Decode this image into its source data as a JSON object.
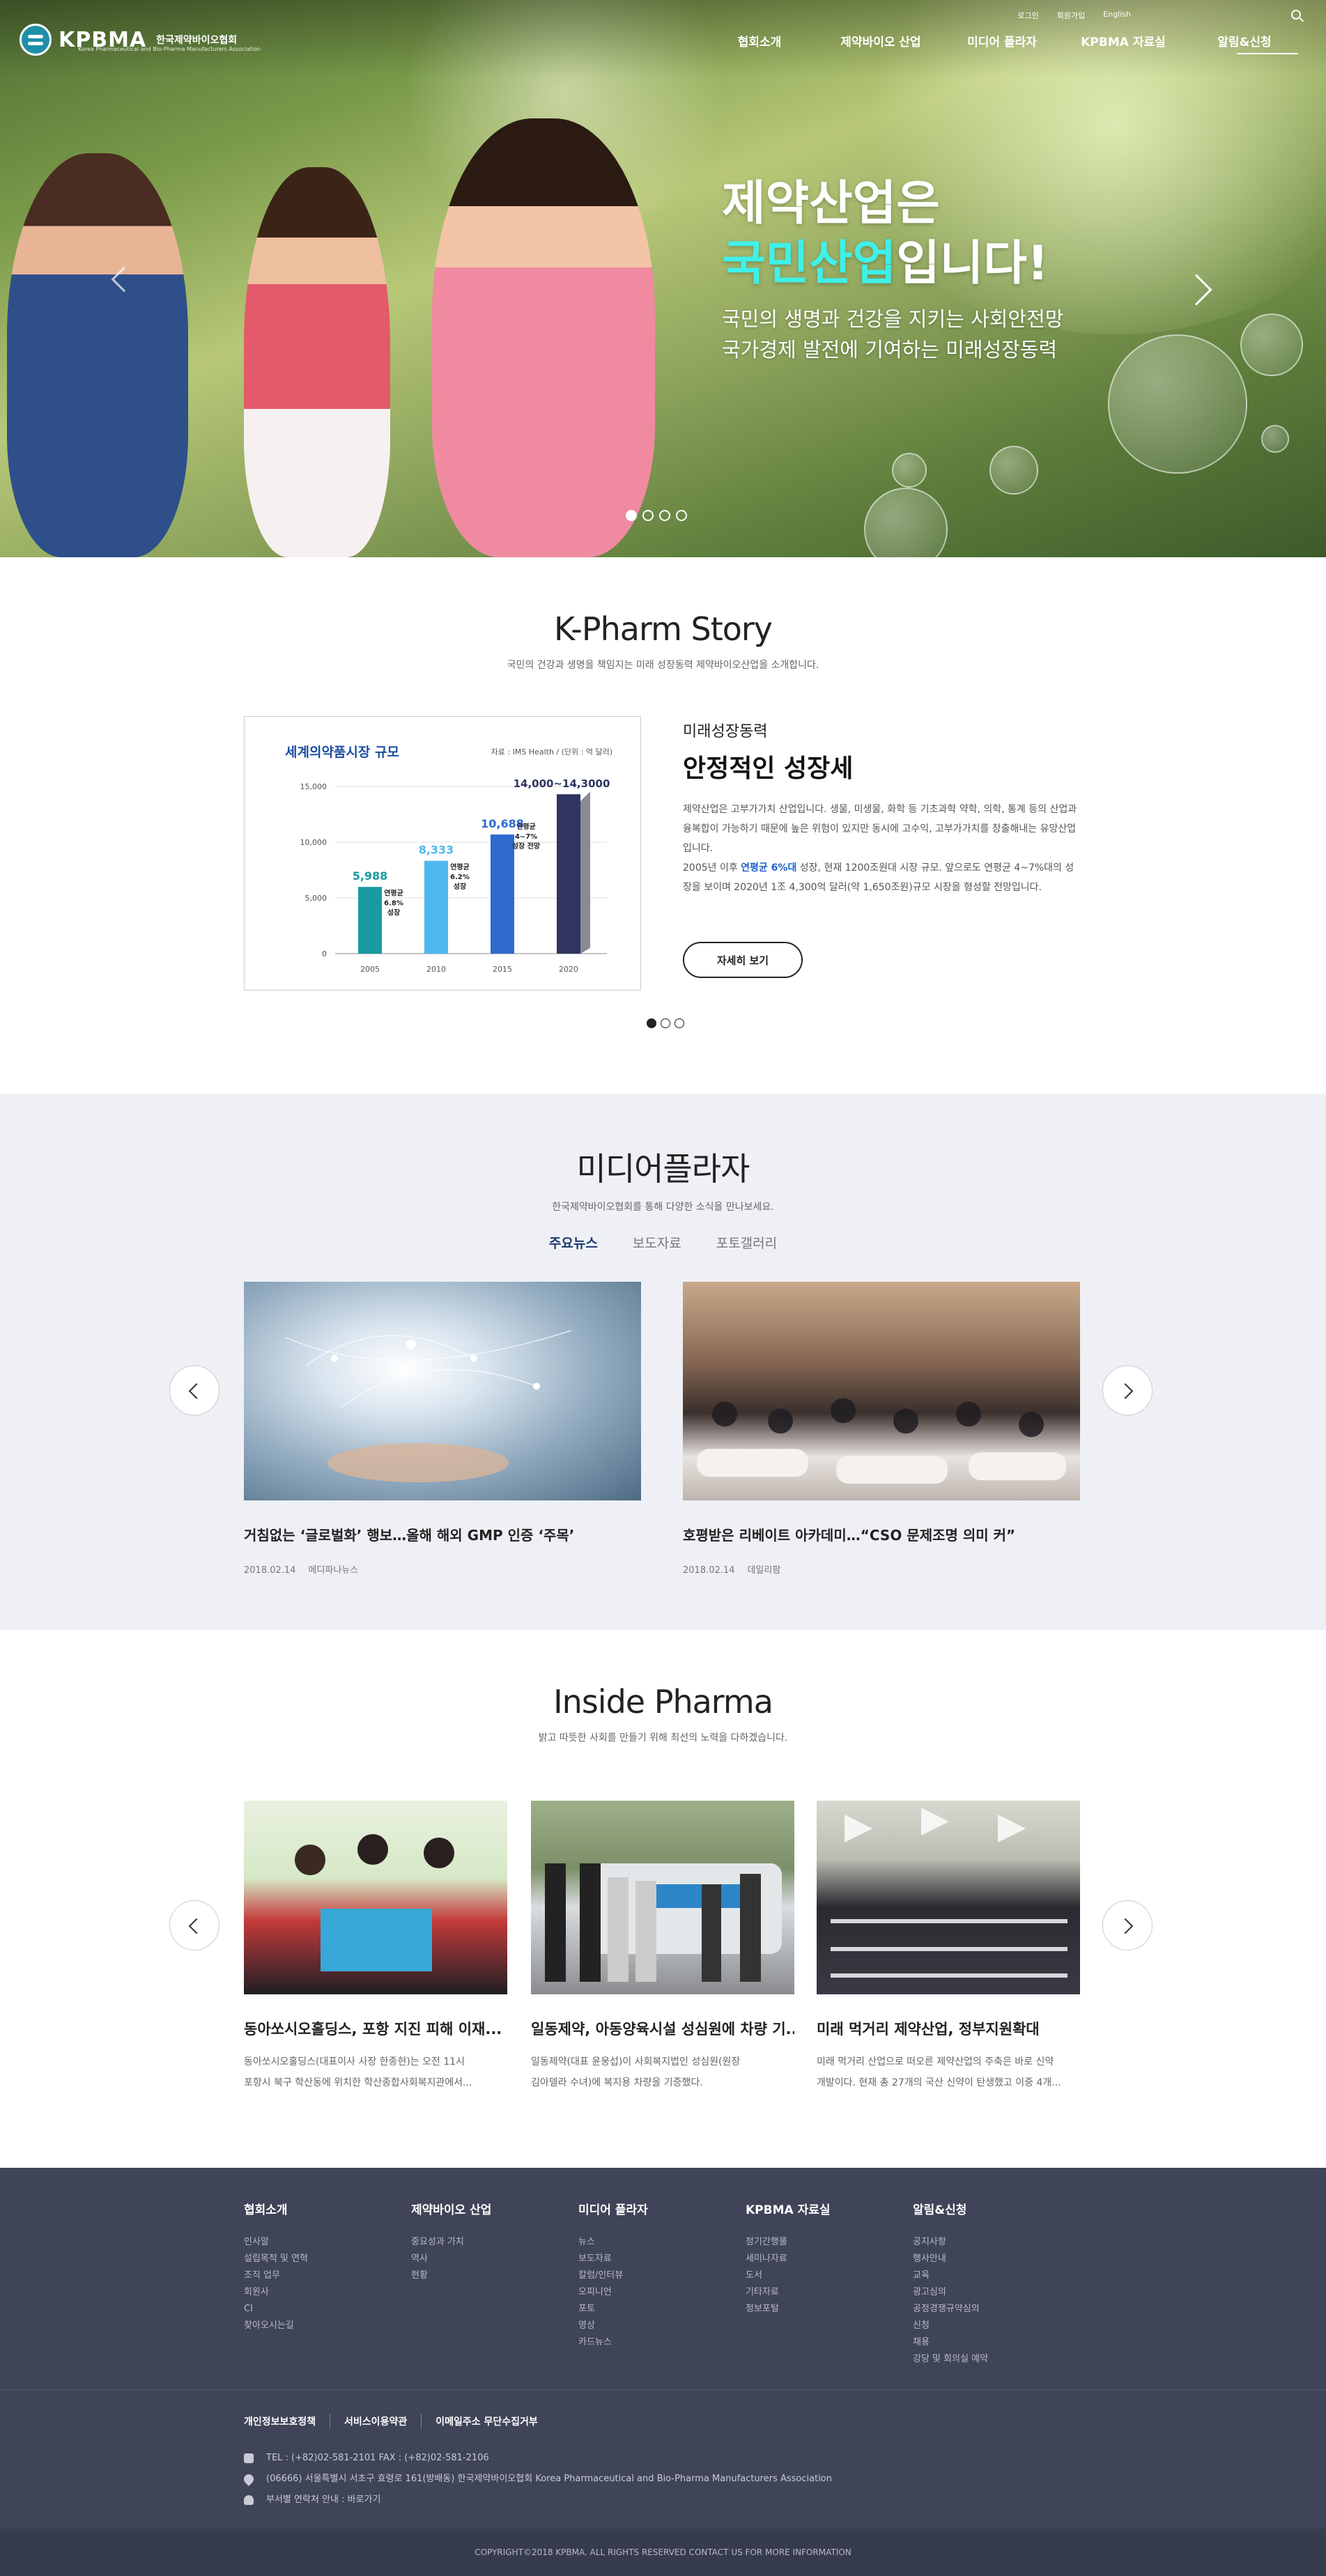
{
  "header": {
    "logo_text": "KPBMA",
    "logo_sub": "한국제약바이오협회",
    "logo_en": "Korea Pharmaceutical and Bio-Pharma Manufacturers Association",
    "util": [
      "로그인",
      "회원가입",
      "English"
    ],
    "gnb": [
      "협회소개",
      "제약바이오 산업",
      "미디어 플라자",
      "KPBMA 자료실",
      "알림&신청"
    ]
  },
  "hero": {
    "line1": "제약산업은",
    "line2_highlight": "국민산업",
    "line2_rest": "입니다!",
    "desc1": "국민의 생명과 건강을 지키는 사회안전망",
    "desc2": "국가경제 발전에 기여하는 미래성장동력"
  },
  "story": {
    "title": "K-Pharm Story",
    "subtitle": "국민의 건강과 생명을 책임지는 미래 성장동력 제약바이오산업을 소개합니다.",
    "kicker": "미래성장동력",
    "headline": "안정적인 성장세",
    "body1": "제약산업은 고부가가치 산업입니다. 생물, 미생물, 화학 등 기초과학 약학, 의학, 통계 등의 산업과 융복합이 가능하기 때문에 높은 위험이 있지만 동시에 고수익, 고부가가치를 창출해내는 유망산업입니다.",
    "body2_pre": "2005년 이후 ",
    "body2_hl": "연평균 6%대",
    "body2_post": " 성장, 현재 1200조원대 시장 규모. 앞으로도 연평균 4~7%대의 성장을 보이며 2020년 1조 4,300억 달러(약 1,650조원)규모 시장을 형성할 전망입니다.",
    "button": "자세히 보기"
  },
  "chart_data": {
    "type": "bar",
    "title": "세계의약품시장 규모",
    "source": "자료 : IMS Health / (단위 : 억 달러)",
    "categories": [
      "2005",
      "2010",
      "2015",
      "2020"
    ],
    "values": [
      5988,
      8333,
      10688,
      14300
    ],
    "value_labels": [
      "5,988",
      "8,333",
      "10,688",
      "14,000~14,3000"
    ],
    "growth_labels": [
      "연평균\n6.8%\n성장",
      "연평균\n6.2%\n성장",
      "연평균\n4~7%\n성장 전망"
    ],
    "yticks": [
      "15,000",
      "10,000",
      "5,000",
      "0"
    ],
    "ytick_values": [
      15000,
      10000,
      5000,
      0
    ],
    "ylim": [
      0,
      15000
    ],
    "colors": [
      "#1a9aa0",
      "#4fb8f0",
      "#2f6ad0",
      "#2f3560"
    ]
  },
  "media": {
    "title": "미디어플라자",
    "subtitle": "한국제약바이오협회를 통해 다양한 소식을 만나보세요.",
    "tabs": [
      "주요뉴스",
      "보도자료",
      "포토갤러리"
    ],
    "cards": [
      {
        "title": "거침없는 ‘글로벌화’ 행보…올해 해외 GMP 인증 ‘주목’",
        "date": "2018.02.14",
        "source": "메디파나뉴스"
      },
      {
        "title": "호평받은 리베이트 아카데미…“CSO 문제조명 의미 커”",
        "date": "2018.02.14",
        "source": "데일리팜"
      }
    ]
  },
  "inside": {
    "title": "Inside Pharma",
    "subtitle": "밝고 따뜻한 사회를 만들기 위해 최선의 노력을 다하겠습니다.",
    "cards": [
      {
        "title": "동아쏘시오홀딩스, 포항 지진 피해 이재...",
        "desc1": "동아쏘시오홀딩스(대표이사 사장 한종현)는 오전 11시",
        "desc2": "포항시 북구 학산동에 위치한 학산종합사회복지관에서..."
      },
      {
        "title": "일동제약, 아동양육시설 성심원에 차량 기...",
        "desc1": "일동제약(대표 윤웅섭)이 사회복지법인 성심원(원장",
        "desc2": "김아델라 수녀)에 복지용 차량을 기증했다."
      },
      {
        "title": "미래 먹거리 제약산업, 정부지원확대",
        "desc1": "미래 먹거리 산업으로 떠오른 제약산업의 주축은 바로 신약",
        "desc2": "개발이다. 현재 총 27개의 국산 신약이 탄생했고 이중 4개..."
      }
    ]
  },
  "footer": {
    "columns": [
      {
        "heading": "협회소개",
        "items": [
          "인사말",
          "설립목적 및 연혁",
          "조직 업무",
          "회원사",
          "CI",
          "찾아오시는길"
        ]
      },
      {
        "heading": "제약바이오 산업",
        "items": [
          "중요성과 가치",
          "역사",
          "현황"
        ]
      },
      {
        "heading": "미디어 플라자",
        "items": [
          "뉴스",
          "보도자료",
          "칼럼/인터뷰",
          "오피니언",
          "포토",
          "영상",
          "카드뉴스"
        ]
      },
      {
        "heading": "KPBMA 자료실",
        "items": [
          "정기간행물",
          "세미나자료",
          "도서",
          "기타자료",
          "정보포털"
        ]
      },
      {
        "heading": "알림&신청",
        "items": [
          "공지사항",
          "행사안내",
          "교육",
          "광고심의",
          "공정경쟁규약심의",
          "신청",
          "채용",
          "강당 및 회의실 예약"
        ]
      }
    ],
    "links": [
      "개인정보보호정책",
      "서비스이용약관",
      "이메일주소 무단수집거부"
    ],
    "tel": "TEL : (+82)02-581-2101   FAX : (+82)02-581-2106",
    "address": "(06666) 서울특별시 서초구 효령로 161(방배동) 한국제약바이오협회 Korea Pharmaceutical and Bio-Pharma Manufacturers Association",
    "contact": "부서별 연락처 안내 : 바로가기",
    "copyright": "COPYRIGHT©2018 KPBMA. ALL RIGHTS RESERVED CONTACT US FOR MORE INFORMATION"
  }
}
